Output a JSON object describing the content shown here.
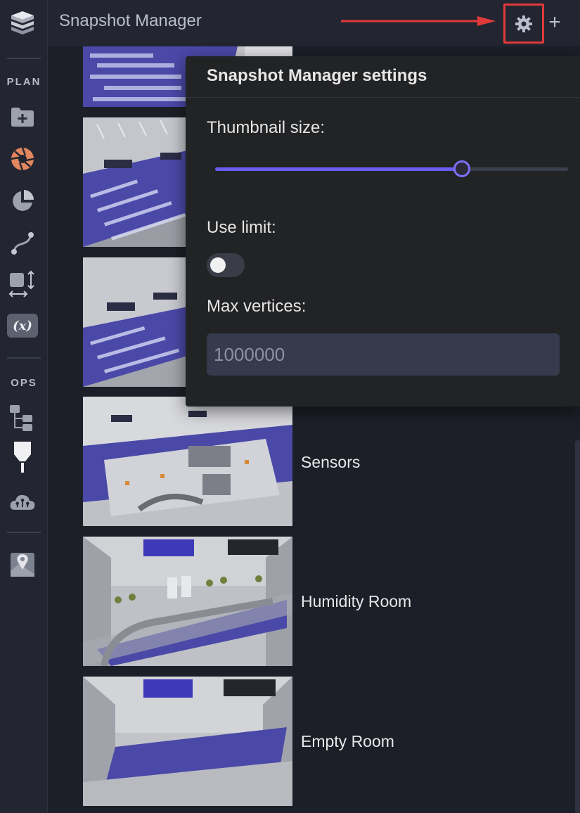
{
  "header": {
    "title": "Snapshot Manager"
  },
  "rail": {
    "plan_label": "PLAN",
    "ops_label": "OPS",
    "variable_glyph": "(x)"
  },
  "snapshots": [
    {
      "label": ""
    },
    {
      "label": ""
    },
    {
      "label": ""
    },
    {
      "label": "Sensors"
    },
    {
      "label": "Humidity Room"
    },
    {
      "label": "Empty Room"
    }
  ],
  "settings": {
    "title": "Snapshot Manager settings",
    "thumbnail_size_label": "Thumbnail size:",
    "thumbnail_size_fraction": 0.7,
    "use_limit_label": "Use limit:",
    "use_limit_on": false,
    "max_vertices_label": "Max vertices:",
    "max_vertices_value": "1000000"
  },
  "colors": {
    "accent": "#6a5ef0",
    "highlight": "#e03a3a",
    "floor": "#4a49a8"
  }
}
